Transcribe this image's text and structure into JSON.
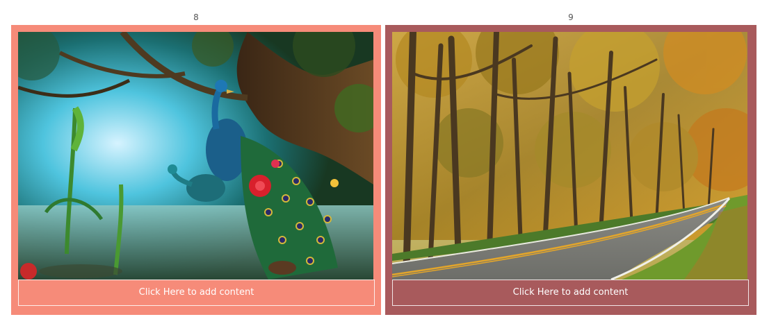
{
  "cards": [
    {
      "number": "8",
      "image_subject": "peacocks in an enchanted forest",
      "caption": "Click Here to add content",
      "frame_color": "#f68b79"
    },
    {
      "number": "9",
      "image_subject": "autumn forest road",
      "caption": "Click Here to add content",
      "frame_color": "#a85a5c"
    }
  ]
}
